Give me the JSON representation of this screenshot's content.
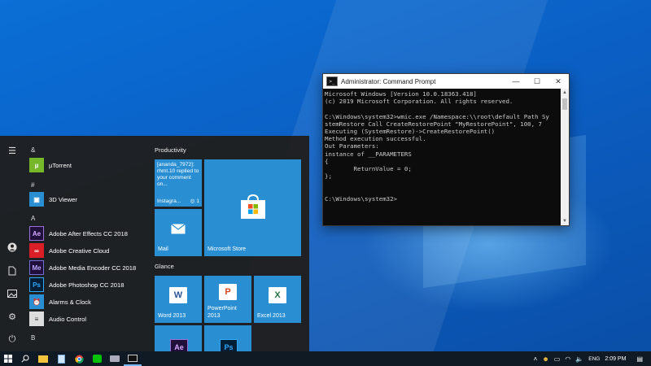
{
  "cmd": {
    "title": "Administrator: Command Prompt",
    "lines": [
      "Microsoft Windows [Version 10.0.18363.418]",
      "(c) 2019 Microsoft Corporation. All rights reserved.",
      "",
      "C:\\Windows\\system32>wmic.exe /Namespace:\\\\root\\default Path Sy",
      "stemRestore Call CreateRestorePoint \"MyRestorePoint\", 100, 7",
      "Executing (SystemRestore)->CreateRestorePoint()",
      "Method execution successful.",
      "Out Parameters:",
      "instance of __PARAMETERS",
      "{",
      "        ReturnValue = 0;",
      "};",
      "",
      "",
      "C:\\Windows\\system32>"
    ],
    "min": "—",
    "max": "☐",
    "close": "✕"
  },
  "start": {
    "headers": {
      "amp": "&",
      "hash": "#",
      "a": "A",
      "b": "B"
    },
    "apps": {
      "utorrent": "µTorrent",
      "viewer3d": "3D Viewer",
      "aftereffects": "Adobe After Effects CC 2018",
      "creativecloud": "Adobe Creative Cloud",
      "mediaencoder": "Adobe Media Encoder CC 2018",
      "photoshop": "Adobe Photoshop CC 2018",
      "alarms": "Alarms & Clock",
      "audiocontrol": "Audio Control"
    },
    "groups": {
      "productivity": "Productivity",
      "glance": "Glance"
    },
    "tiles": {
      "instagram_text": "[ananda_7972]: rhmt.10 replied to your comment on...",
      "instagram_label": "Instagra...",
      "instagram_count": "1",
      "mail": "Mail",
      "store": "Microsoft Store",
      "word": "Word 2013",
      "powerpoint": "PowerPoint 2013",
      "excel": "Excel 2013",
      "ae_abbr": "Ae",
      "ps_abbr": "Ps"
    },
    "app_abbr": {
      "ae": "Ae",
      "me": "Me",
      "ps": "Ps"
    }
  },
  "taskbar": {
    "time": "2:09 PM",
    "lang": "ENG"
  },
  "colors": {
    "tile_blue": "#2a8fd2",
    "word": "#2b579a",
    "powerpoint": "#d24726",
    "excel": "#217346",
    "adobe_ae": "#1f0f3a",
    "adobe_ps": "#001e36"
  }
}
